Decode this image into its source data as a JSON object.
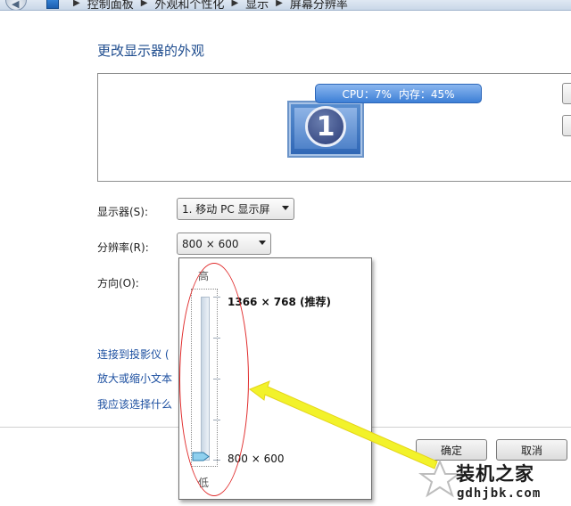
{
  "breadcrumb": {
    "items": [
      "控制面板",
      "外观和个性化",
      "显示",
      "屏幕分辨率"
    ]
  },
  "page": {
    "title": "更改显示器的外观"
  },
  "preview": {
    "monitor_number": "1",
    "cpu_label": "CPU：7%",
    "mem_label": "内存：45%"
  },
  "display": {
    "label": "显示器(S):",
    "value": "1. 移动 PC 显示屏"
  },
  "resolution": {
    "label": "分辨率(R):",
    "value": "800 × 600"
  },
  "orientation": {
    "label": "方向(O):"
  },
  "links": {
    "projector": "连接到投影仪 (",
    "text_size": "放大或缩小文本",
    "which": "我应该选择什么"
  },
  "popup": {
    "high": "高",
    "low": "低",
    "top_option": "1366 × 768 (推荐)",
    "bottom_option": "800 × 600"
  },
  "buttons": {
    "ok": "确定",
    "cancel": "取消"
  },
  "watermark": {
    "name": "装机之家",
    "url": "gdhjbk.com"
  },
  "colors": {
    "heading": "#1f4d8f",
    "link": "#1c4fa0",
    "annotation_ellipse": "#e02a2a",
    "annotation_arrow": "#f2f22a"
  },
  "icons": {
    "nav": "back-arrow-icon",
    "control_panel": "control-panel-icon",
    "slider": "slider-thumb-icon"
  }
}
